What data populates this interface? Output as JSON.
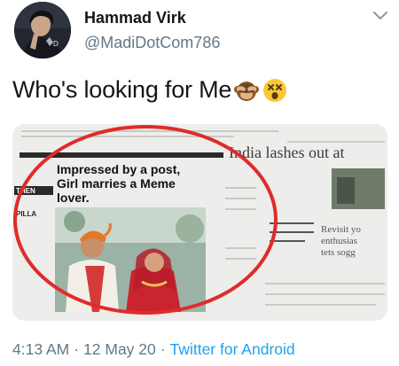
{
  "tweet": {
    "display_name": "Hammad Virk",
    "handle": "@MadiDotCom786",
    "text": "Who's looking for Me",
    "emojis": [
      "see-no-evil-monkey",
      "dizzy-face"
    ],
    "time": "4:13 AM",
    "separator1": "·",
    "date": "12 May 20",
    "separator2": "·",
    "source": "Twitter for Android"
  },
  "media": {
    "headline": "Impressed by a post, Girl marries a Meme lover.",
    "headline_lines": [
      "Impressed by a post,",
      "Girl marries a Meme",
      "lover."
    ],
    "side_headline": "India lashes out at",
    "side_text": [
      "Revisit yo",
      "enthusias",
      "tets sogg"
    ],
    "label_then": "THEN",
    "label_pillar": "PILLA",
    "highlight_color": "#e02b2b"
  },
  "colors": {
    "link": "#1da1f2",
    "secondary_text": "#657786"
  }
}
